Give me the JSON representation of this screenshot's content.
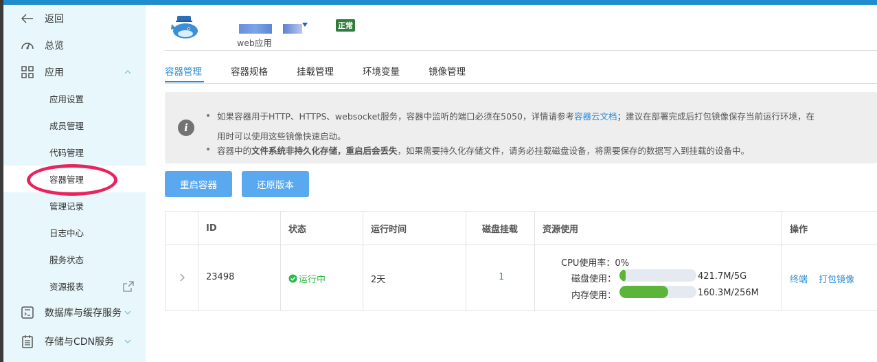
{
  "sidebar": {
    "back": "返回",
    "overview": "总览",
    "app": "应用",
    "sub_items": [
      "应用设置",
      "成员管理",
      "代码管理",
      "容器管理",
      "管理记录",
      "日志中心",
      "服务状态",
      "资源报表"
    ],
    "database": "数据库与缓存服务",
    "storage": "存储与CDN服务"
  },
  "app": {
    "type": "web应用",
    "status_badge": "正常"
  },
  "tabs": [
    "容器管理",
    "容器规格",
    "挂载管理",
    "环境变量",
    "镜像管理"
  ],
  "notice": {
    "line1_pre": "如果容器用于HTTP、HTTPS、websocket服务，容器中监听的端口必须在5050，详情请参考",
    "line1_link": "容器云文档",
    "line1_post": "；建议在部署完成后打包镜像保存当前运行环境，在",
    "line2": "用时可以使用这些镜像快速启动。",
    "line3_pre": "容器中的",
    "line3_bold": "文件系统非持久化存储，重启后会丢失",
    "line3_post": "，如果需要持久化存储文件，请务必挂载磁盘设备，将需要保存的数据写入到挂载的设备中。"
  },
  "buttons": {
    "restart": "重启容器",
    "restore": "还原版本"
  },
  "table": {
    "headers": {
      "id": "ID",
      "status": "状态",
      "runtime": "运行时间",
      "disk": "磁盘挂载",
      "resource": "资源使用",
      "ops": "操作"
    },
    "row": {
      "id": "23498",
      "status": "运行中",
      "runtime": "2天",
      "disk": "1",
      "cpu": "CPU使用率：0%",
      "disk_label": "磁盘使用：",
      "disk_value": "421.7M/5G",
      "disk_fraction": 0.08,
      "mem_label": "内存使用：",
      "mem_value": "160.3M/256M",
      "mem_fraction": 0.63,
      "op_terminal": "终端",
      "op_pack": "打包镜像"
    }
  },
  "colors": {
    "accent": "#2a8ad4",
    "button": "#5aa9f0",
    "success": "#2db84b",
    "highlight": "#e8245e"
  }
}
